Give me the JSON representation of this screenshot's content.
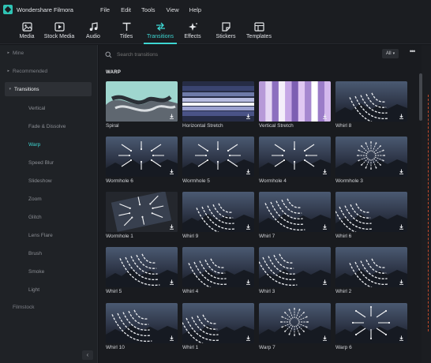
{
  "app": {
    "name": "Wondershare Filmora"
  },
  "menu": [
    "File",
    "Edit",
    "Tools",
    "View",
    "Help"
  ],
  "toolbar": [
    {
      "label": "Media",
      "icon": "media-icon"
    },
    {
      "label": "Stock Media",
      "icon": "stock-media-icon"
    },
    {
      "label": "Audio",
      "icon": "music-note-icon"
    },
    {
      "label": "Titles",
      "icon": "text-t-icon"
    },
    {
      "label": "Transitions",
      "icon": "transitions-icon",
      "active": true
    },
    {
      "label": "Effects",
      "icon": "sparkle-icon"
    },
    {
      "label": "Stickers",
      "icon": "sticker-icon"
    },
    {
      "label": "Templates",
      "icon": "templates-icon"
    }
  ],
  "sidebar": {
    "top_items": [
      "Mine",
      "Recommended",
      "Transitions"
    ],
    "sub_items": [
      "Vertical",
      "Fade & Dissolve",
      "Warp",
      "Speed Blur",
      "Slideshow",
      "Zoom",
      "Glitch",
      "Lens Flare",
      "Brush",
      "Smoke",
      "Light"
    ],
    "active_sub": "Warp",
    "bottom_item": "Filmstock",
    "collapse_glyph": "‹"
  },
  "search": {
    "placeholder": "Search transitions"
  },
  "filter": {
    "selected": "All"
  },
  "more_glyph": "•••",
  "section": {
    "title": "WARP"
  },
  "transitions": [
    {
      "label": "Spiral",
      "thumb": "spiral"
    },
    {
      "label": "Horizontal Stretch",
      "thumb": "hstretch"
    },
    {
      "label": "Vertical Stretch",
      "thumb": "vstretch"
    },
    {
      "label": "Whirl 8",
      "thumb": "whirl"
    },
    {
      "label": "Wormhole 6",
      "thumb": "inward"
    },
    {
      "label": "Wormhole 5",
      "thumb": "inward"
    },
    {
      "label": "Wormhole 4",
      "thumb": "inward"
    },
    {
      "label": "Wormhole 3",
      "thumb": "radial"
    },
    {
      "label": "Wormhole 1",
      "thumb": "tilted"
    },
    {
      "label": "Whirl 9",
      "thumb": "whirl"
    },
    {
      "label": "Whirl 7",
      "thumb": "whirl"
    },
    {
      "label": "Whirl 6",
      "thumb": "whirl"
    },
    {
      "label": "Whirl 5",
      "thumb": "whirl"
    },
    {
      "label": "Whirl 4",
      "thumb": "whirl"
    },
    {
      "label": "Whirl 3",
      "thumb": "whirl"
    },
    {
      "label": "Whirl 2",
      "thumb": "whirl"
    },
    {
      "label": "Whirl 10",
      "thumb": "whirl"
    },
    {
      "label": "Whirl 1",
      "thumb": "whirl"
    },
    {
      "label": "Warp 7",
      "thumb": "radial"
    },
    {
      "label": "Warp 6",
      "thumb": "outward"
    }
  ],
  "colors": {
    "accent": "#3ed6d2",
    "background": "#191b1f",
    "sidebar": "#1f2226"
  }
}
